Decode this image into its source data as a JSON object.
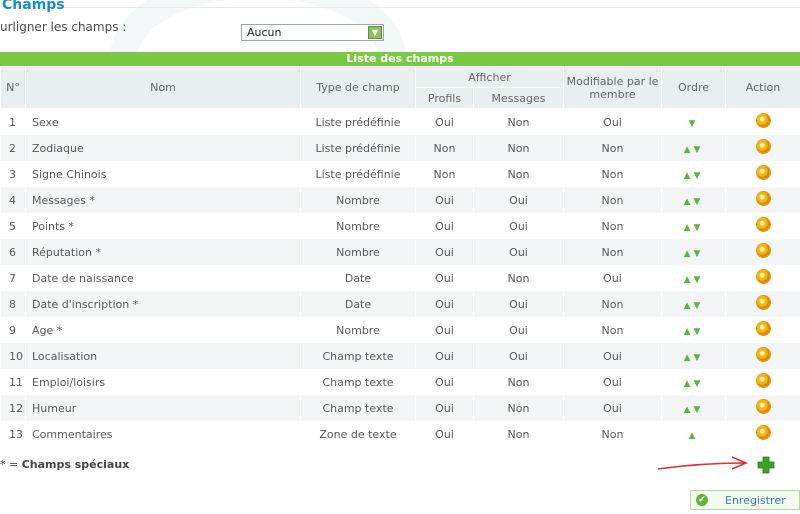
{
  "header": {
    "title": "Champs",
    "highlight_label": "urligner les champs :",
    "highlight_select_value": "Aucun"
  },
  "table": {
    "caption": "Liste des champs",
    "columns": {
      "num": "N°",
      "nom": "Nom",
      "type": "Type de champ",
      "afficher": "Afficher",
      "profils": "Profils",
      "messages": "Messages",
      "modifiable": "Modifiable par le membre",
      "ordre": "Ordre",
      "action": "Action"
    },
    "rows": [
      {
        "num": "1",
        "nom": "Sexe",
        "type": "Liste prédéfinie",
        "profils": "Oui",
        "messages": "Non",
        "modifiable": "Oui",
        "order": "down"
      },
      {
        "num": "2",
        "nom": "Zodiaque",
        "type": "Liste prédéfinie",
        "profils": "Non",
        "messages": "Non",
        "modifiable": "Non",
        "order": "both"
      },
      {
        "num": "3",
        "nom": "Signe Chinois",
        "type": "Liste prédéfinie",
        "profils": "Non",
        "messages": "Non",
        "modifiable": "Non",
        "order": "both"
      },
      {
        "num": "4",
        "nom": "Messages *",
        "type": "Nombre",
        "profils": "Oui",
        "messages": "Oui",
        "modifiable": "Non",
        "order": "both"
      },
      {
        "num": "5",
        "nom": "Points *",
        "type": "Nombre",
        "profils": "Oui",
        "messages": "Oui",
        "modifiable": "Non",
        "order": "both"
      },
      {
        "num": "6",
        "nom": "Réputation *",
        "type": "Nombre",
        "profils": "Oui",
        "messages": "Oui",
        "modifiable": "Non",
        "order": "both"
      },
      {
        "num": "7",
        "nom": "Date de naissance",
        "type": "Date",
        "profils": "Oui",
        "messages": "Non",
        "modifiable": "Oui",
        "order": "both"
      },
      {
        "num": "8",
        "nom": "Date d'inscription *",
        "type": "Date",
        "profils": "Oui",
        "messages": "Oui",
        "modifiable": "Non",
        "order": "both"
      },
      {
        "num": "9",
        "nom": "Age *",
        "type": "Nombre",
        "profils": "Oui",
        "messages": "Oui",
        "modifiable": "Non",
        "order": "both"
      },
      {
        "num": "10",
        "nom": "Localisation",
        "type": "Champ texte",
        "profils": "Oui",
        "messages": "Oui",
        "modifiable": "Oui",
        "order": "both"
      },
      {
        "num": "11",
        "nom": "Emploi/loisirs",
        "type": "Champ texte",
        "profils": "Oui",
        "messages": "Non",
        "modifiable": "Oui",
        "order": "both"
      },
      {
        "num": "12",
        "nom": "Humeur",
        "type": "Champ texte",
        "profils": "Oui",
        "messages": "Non",
        "modifiable": "Oui",
        "order": "both"
      },
      {
        "num": "13",
        "nom": "Commentaires",
        "type": "Zone de texte",
        "profils": "Oui",
        "messages": "Non",
        "modifiable": "Non",
        "order": "up"
      }
    ]
  },
  "footer": {
    "footnote_star": "* = ",
    "footnote_text": "Champs spéciaux",
    "save_label": "Enregistrer"
  },
  "icons": {
    "order_up": "arrow-up-icon",
    "order_down": "arrow-down-icon",
    "action": "gear-icon",
    "add": "plus-icon",
    "save": "check-icon"
  },
  "colors": {
    "accent_green": "#7ac943",
    "title_blue": "#1a8fc7",
    "header_bg": "#e9eef1",
    "arrow_red": "#d9322b"
  }
}
